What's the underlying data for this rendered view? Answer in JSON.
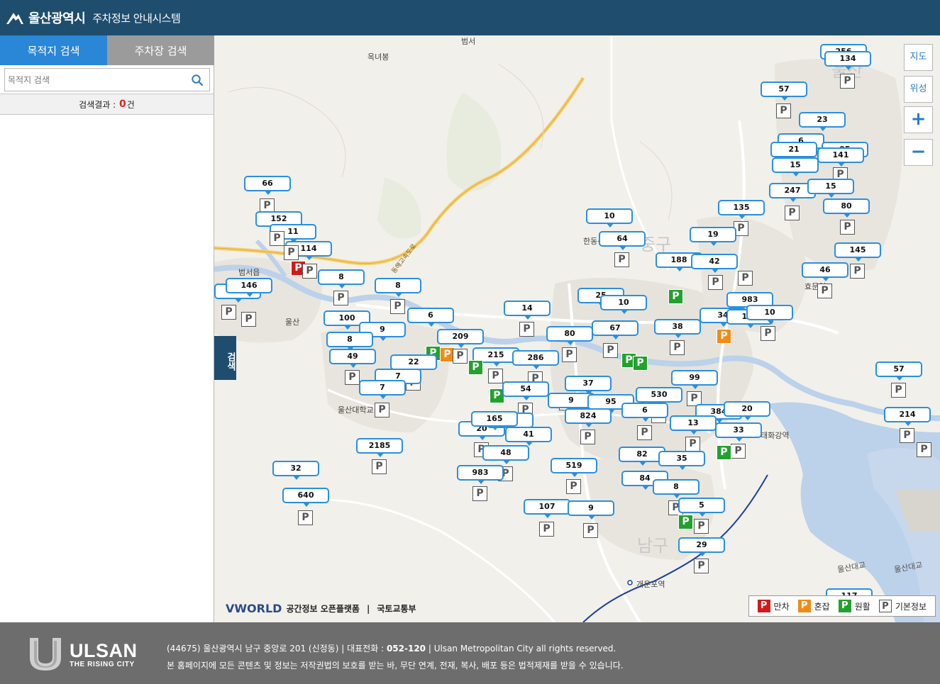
{
  "header": {
    "org_name": "울산광역시",
    "system_title": "주차정보 안내시스템"
  },
  "sidebar": {
    "tabs": [
      "목적지 검색",
      "주차장 검색"
    ],
    "search_placeholder": "목적지 검색",
    "result_label": "검색결과 :",
    "result_count": "0",
    "result_unit": "건"
  },
  "map": {
    "controls": {
      "map_view": "지도",
      "satellite_view": "위성",
      "zoom_in": "+",
      "zoom_out": "−"
    },
    "search_toggle": "검색",
    "place_labels": [
      "범서",
      "옥녀봉",
      "범서읍",
      "울산",
      "한동산대",
      "중구",
      "효문역",
      "울산대학교",
      "남구",
      "개운포역",
      "울산대교",
      "울산대교",
      "태화강역",
      "울산",
      "동해고속도로"
    ],
    "parking_counts": [
      "256",
      "134",
      "57",
      "23",
      "6",
      "21",
      "95",
      "141",
      "15",
      "247",
      "15",
      "80",
      "135",
      "10",
      "64",
      "19",
      "145",
      "188",
      "42",
      "46",
      "66",
      "152",
      "11",
      "114",
      "8",
      "60",
      "146",
      "8",
      "25",
      "10",
      "983",
      "14",
      "100",
      "9",
      "6",
      "209",
      "8",
      "49",
      "22",
      "7",
      "7",
      "215",
      "286",
      "80",
      "67",
      "38",
      "34",
      "106",
      "10",
      "54",
      "37",
      "99",
      "530",
      "9",
      "95",
      "824",
      "6",
      "384",
      "20",
      "2185",
      "20",
      "330",
      "165",
      "41",
      "48",
      "13",
      "33",
      "57",
      "214",
      "32",
      "519",
      "82",
      "35",
      "640",
      "983",
      "84",
      "8",
      "107",
      "9",
      "5",
      "29",
      "117"
    ],
    "attribution": {
      "brand": "VWORLD",
      "provider": "공간정보 오픈플랫폼",
      "ministry": "국토교통부"
    },
    "legend": [
      {
        "label": "만차",
        "color": "#d11a1a"
      },
      {
        "label": "혼잡",
        "color": "#f08c16"
      },
      {
        "label": "원활",
        "color": "#23a12f"
      },
      {
        "label": "기본정보",
        "color": "#ffffff"
      }
    ]
  },
  "footer": {
    "logo_name": "ULSAN",
    "logo_slogan": "THE RISING CITY",
    "address": "(44675) 울산광역시 남구 중앙로 201 (신정동)",
    "phone_label": "대표전화 :",
    "phone": "052-120",
    "copyright": "Ulsan Metropolitan City all rights reserved.",
    "notice": "본 홈페이지에 모든 콘텐츠 및 정보는 저작권법의 보호를 받는 바, 무단 연계, 전재, 복사, 배포 등은 법적제재를 받을 수 있습니다."
  }
}
